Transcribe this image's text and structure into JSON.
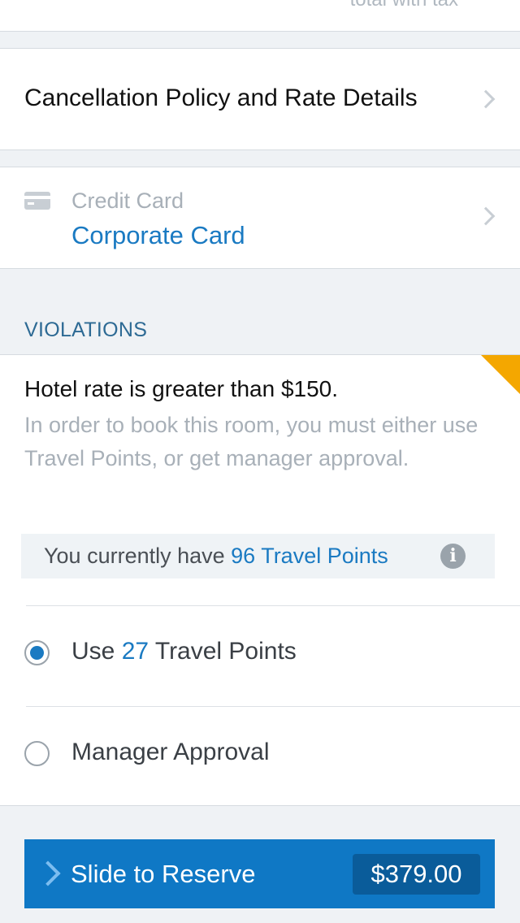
{
  "top": {
    "cut_text": "total with tax"
  },
  "policy": {
    "label": "Cancellation Policy and Rate Details"
  },
  "payment": {
    "title": "Credit Card",
    "value": "Corporate Card"
  },
  "violations": {
    "heading": "VIOLATIONS",
    "title": "Hotel rate is greater than $150.",
    "description": "In order to  book this room, you must either use Travel Points, or get manager approval.",
    "points_prefix": "You currently have ",
    "points_value": "96 Travel Points",
    "flag_color": "#f4a700"
  },
  "options": [
    {
      "prefix": "Use ",
      "highlight": "27",
      "suffix": " Travel Points",
      "selected": true
    },
    {
      "label": "Manager Approval",
      "selected": false
    }
  ],
  "reserve": {
    "label": "Slide to Reserve",
    "price": "$379.00",
    "color": "#0f78c5"
  },
  "accent_color": "#1a7ac2"
}
